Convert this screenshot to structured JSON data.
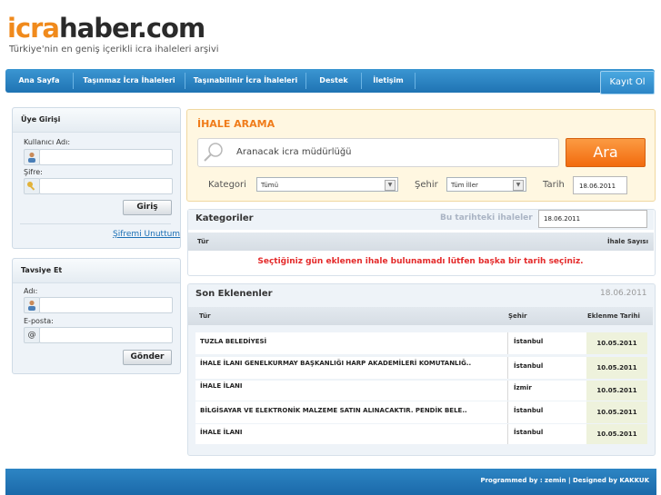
{
  "header": {
    "logo_part1": "icra",
    "logo_part2": "haber.com",
    "tagline": "Türkiye'nin en geniş içerikli icra ihaleleri arşivi"
  },
  "nav": {
    "items": [
      "Ana Sayfa",
      "Taşınmaz İcra İhaleleri",
      "Taşınabilinir İcra İhaleleri",
      "Destek",
      "İletişim"
    ],
    "register": "Kayıt Ol"
  },
  "login": {
    "title": "Üye Girişi",
    "username_label": "Kullanıcı Adı:",
    "password_label": "Şifre:",
    "submit": "Giriş",
    "forgot": "Şifremi Unuttum"
  },
  "recommend": {
    "title": "Tavsiye Et",
    "name_label": "Adı:",
    "email_label": "E-posta:",
    "email_icon": "@",
    "submit": "Gönder"
  },
  "search": {
    "title": "İHALE ARAMA",
    "placeholder": "Aranacak icra müdürlüğü",
    "button": "Ara",
    "category_label": "Kategori",
    "category_value": "Tümü",
    "city_label": "Şehir",
    "city_value": "Tüm İller",
    "date_label": "Tarih",
    "date_value": "18.06.2011"
  },
  "categories": {
    "title": "Kategoriler",
    "date_prompt": "Bu tarihteki ihaleler",
    "date_value": "18.06.2011",
    "col_type": "Tür",
    "col_count": "İhale Sayısı",
    "empty_message": "Seçtiğiniz gün eklenen ihale bulunamadı lütfen başka bir tarih seçiniz."
  },
  "recent": {
    "title": "Son Eklenenler",
    "date": "18.06.2011",
    "col_type": "Tür",
    "col_city": "Şehir",
    "col_date": "Eklenme Tarihi",
    "rows": [
      {
        "title": "TUZLA BELEDİYESİ",
        "city": "İstanbul",
        "date": "10.05.2011"
      },
      {
        "title": "İHALE İLANI GENELKURMAY BAŞKANLIĞI HARP AKADEMİLERİ KOMUTANLIĞ..",
        "city": "İstanbul",
        "date": "10.05.2011"
      },
      {
        "title": "İHALE İLANI",
        "city": "İzmir",
        "date": "10.05.2011"
      },
      {
        "title": "BİLGİSAYAR VE ELEKTRONİK MALZEME SATIN ALINACAKTIR. PENDİK BELE..",
        "city": "İstanbul",
        "date": "10.05.2011"
      },
      {
        "title": "İHALE İLANI",
        "city": "İstanbul",
        "date": "10.05.2011"
      }
    ]
  },
  "footer": {
    "text": "Programmed by : zemin | Designed by KAKKUK"
  }
}
